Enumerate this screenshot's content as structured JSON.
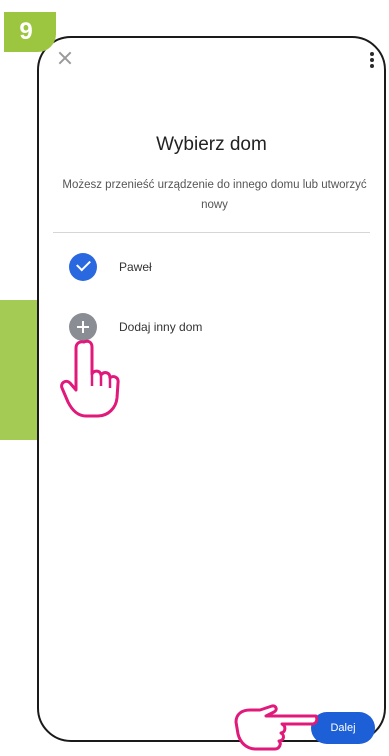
{
  "step": {
    "number": "9"
  },
  "header": {
    "close_icon": "close-icon",
    "menu_icon": "more-vert-icon"
  },
  "page": {
    "title": "Wybierz dom",
    "subtitle": "Możesz przenieść urządzenie do innego domu lub utworzyć nowy"
  },
  "homes": [
    {
      "label": "Paweł",
      "icon": "check-icon",
      "selected": true
    },
    {
      "label": "Dodaj inny dom",
      "icon": "plus-icon",
      "selected": false
    }
  ],
  "footer": {
    "next_label": "Dalej"
  },
  "colors": {
    "accent": "#2a68e0",
    "button": "#1d5fd6",
    "badge": "#9cc63f",
    "pointer": "#e0197a"
  }
}
